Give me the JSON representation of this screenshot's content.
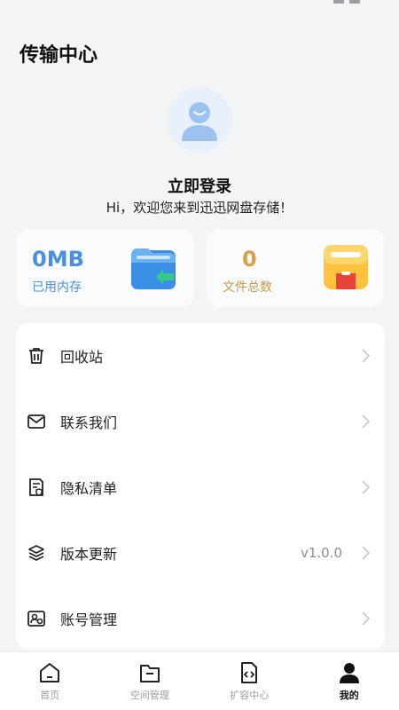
{
  "header": {
    "title": "传输中心"
  },
  "profile": {
    "login_label": "立即登录",
    "welcome_message": "Hi，欢迎您来到迅迅网盘存储！"
  },
  "stats": {
    "used_storage": {
      "value": "0MB",
      "label": "已用内存",
      "color": "#4a90e2"
    },
    "file_count": {
      "value": "0",
      "label": "文件总数",
      "color": "#d9a14a"
    }
  },
  "menu": {
    "items": [
      {
        "label": "回收站",
        "icon": "trash-icon",
        "value": ""
      },
      {
        "label": "联系我们",
        "icon": "mail-icon",
        "value": ""
      },
      {
        "label": "隐私清单",
        "icon": "privacy-document-icon",
        "value": ""
      },
      {
        "label": "版本更新",
        "icon": "layers-icon",
        "value": "v1.0.0"
      },
      {
        "label": "账号管理",
        "icon": "account-settings-icon",
        "value": ""
      }
    ]
  },
  "tabbar": {
    "tabs": [
      {
        "label": "首页",
        "icon": "home-icon",
        "active": false
      },
      {
        "label": "空间管理",
        "icon": "folder-icon",
        "active": false
      },
      {
        "label": "扩容中心",
        "icon": "code-file-icon",
        "active": false
      },
      {
        "label": "我的",
        "icon": "person-icon",
        "active": true
      }
    ]
  }
}
